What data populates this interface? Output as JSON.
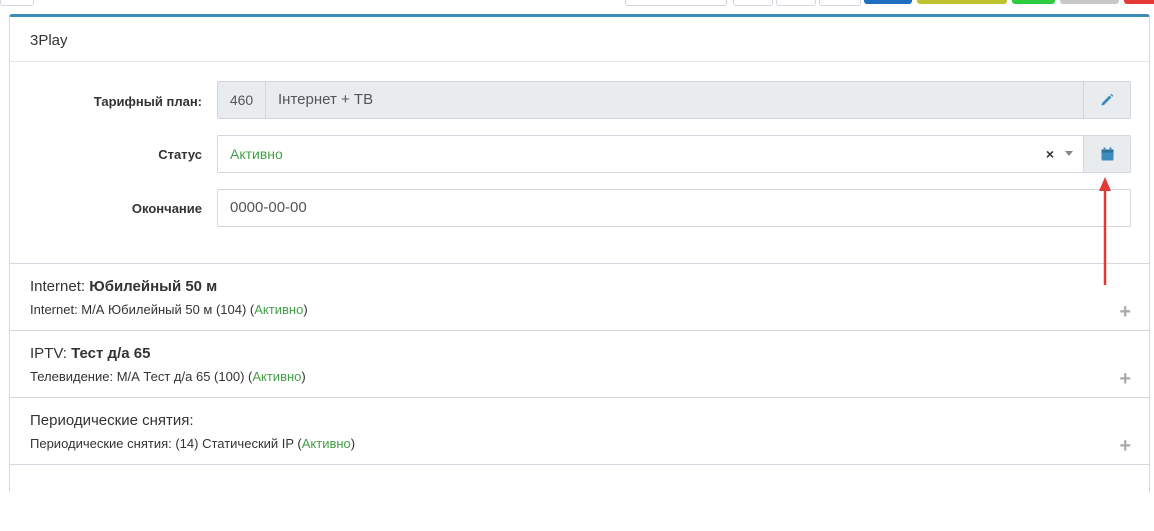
{
  "card": {
    "title": "3Play"
  },
  "tariff": {
    "label": "Тарифный план:",
    "code": "460",
    "name": "Інтернет + ТВ",
    "edit_icon": "pencil-icon"
  },
  "status": {
    "label": "Статус",
    "value": "Активно",
    "clear": "×",
    "calendar_icon": "calendar-icon"
  },
  "end": {
    "label": "Окончание",
    "value": "0000-00-00"
  },
  "services": [
    {
      "type": "Internet:",
      "name": "Юбилейный 50 м",
      "detail_prefix": "Internet: М/А Юбилейный 50 м (104) (",
      "status": "Активно",
      "detail_suffix": ")"
    },
    {
      "type": "IPTV:",
      "name": "Тест д/а 65",
      "detail_prefix": "Телевидение: М/А Тест д/а 65 (100) (",
      "status": "Активно",
      "detail_suffix": ")"
    },
    {
      "type": "Периодические снятия:",
      "name": "",
      "detail_prefix": "Периодические снятия: (14) Статический IP (",
      "status": "Активно",
      "detail_suffix": ")"
    }
  ],
  "colors": {
    "accent": "#3c8dbc",
    "active_green": "#43a047",
    "annotation_red": "#e53935",
    "toolbar_blue": "#1e6fbf",
    "toolbar_olive": "#c0c12f",
    "toolbar_green": "#2ecc40",
    "toolbar_gray": "#c8c8c8",
    "toolbar_red": "#e53935"
  }
}
